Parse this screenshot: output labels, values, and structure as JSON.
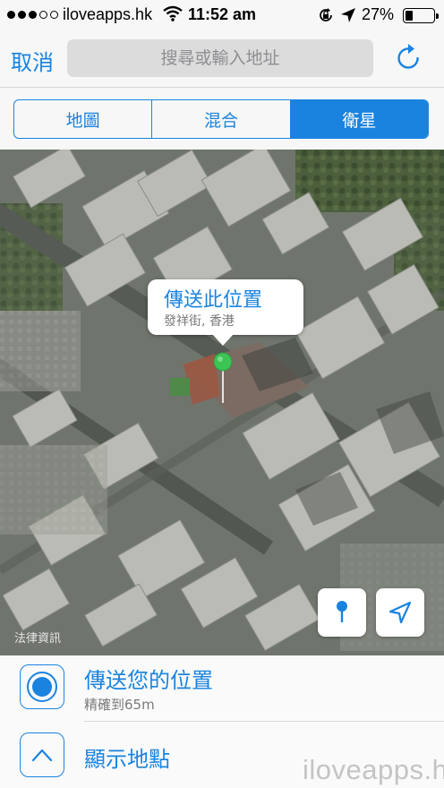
{
  "status_bar": {
    "carrier": "iloveapps.hk",
    "time": "11:52 am",
    "battery_text": "27%",
    "battery_level": 0.27,
    "signal_bars_filled": 3,
    "signal_bars_total": 5
  },
  "nav": {
    "cancel_label": "取消",
    "search_placeholder": "搜尋或輸入地址",
    "refresh_icon": "refresh-icon"
  },
  "segments": {
    "items": [
      "地圖",
      "混合",
      "衛星"
    ],
    "selected": "衛星"
  },
  "map": {
    "callout_title": "傳送此位置",
    "callout_subtitle": "發祥街, 香港",
    "legal_label": "法律資訊",
    "pin_color": "#3cc455",
    "buttons": [
      "drop-pin-icon",
      "location-arrow-icon"
    ]
  },
  "actions": {
    "send_location_title": "傳送您的位置",
    "send_location_subtitle": "精確到65m",
    "show_places_title": "顯示地點"
  },
  "watermark": "iloveapps.hk",
  "colors": {
    "accent": "#1a83e0",
    "background": "#f7f7f7"
  }
}
